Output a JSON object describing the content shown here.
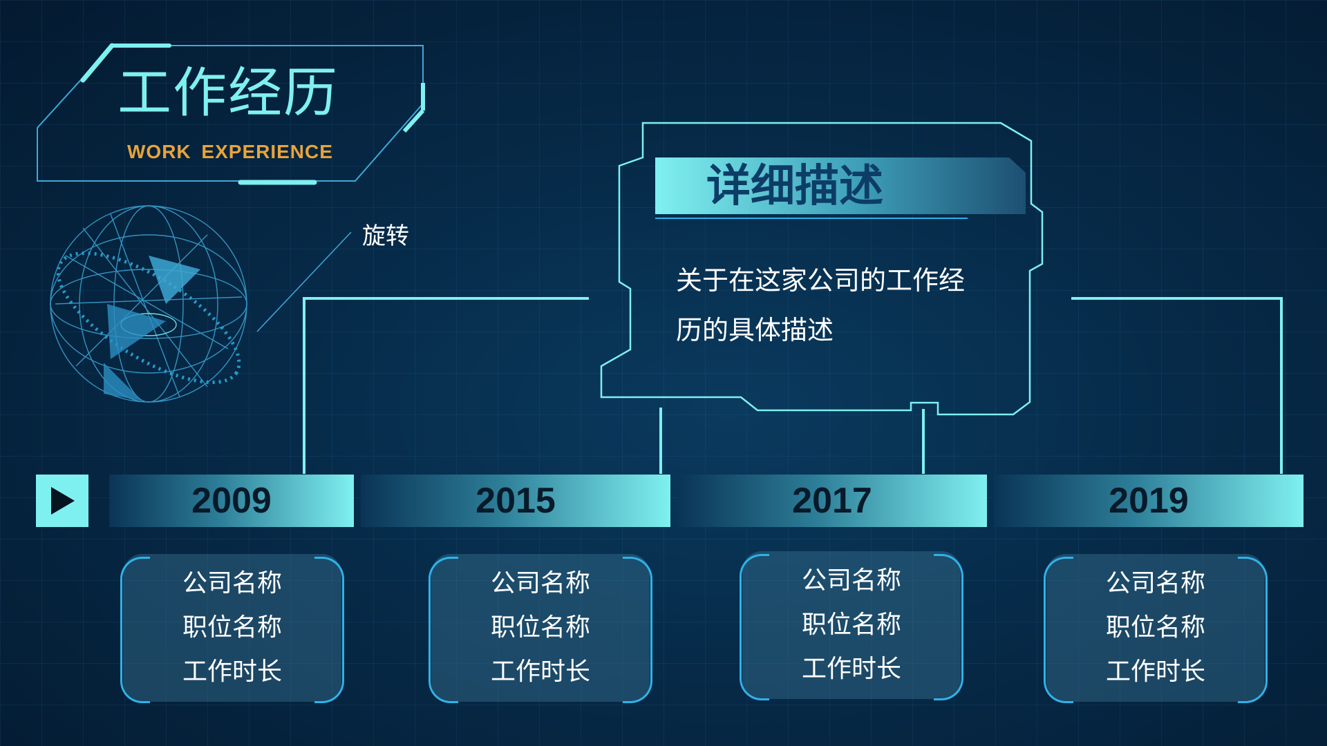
{
  "header": {
    "title": "工作经历",
    "subtitle": "WORK  EXPERIENCE"
  },
  "globe": {
    "label": "旋转",
    "icon": "wireframe-globe-icon"
  },
  "detail": {
    "title": "详细描述",
    "description_line1": "关于在这家公司的工作经",
    "description_line2": "历的具体描述"
  },
  "timeline": {
    "play_icon": "play-icon",
    "years": [
      {
        "year": "2009",
        "company": "公司名称",
        "position": "职位名称",
        "duration": "工作时长"
      },
      {
        "year": "2015",
        "company": "公司名称",
        "position": "职位名称",
        "duration": "工作时长"
      },
      {
        "year": "2017",
        "company": "公司名称",
        "position": "职位名称",
        "duration": "工作时长"
      },
      {
        "year": "2019",
        "company": "公司名称",
        "position": "职位名称",
        "duration": "工作时长"
      }
    ]
  },
  "colors": {
    "accent_cyan": "#7ff0f0",
    "title_orange": "#e8a43a",
    "card_border": "#2fb2e8",
    "background": "#062a48"
  }
}
